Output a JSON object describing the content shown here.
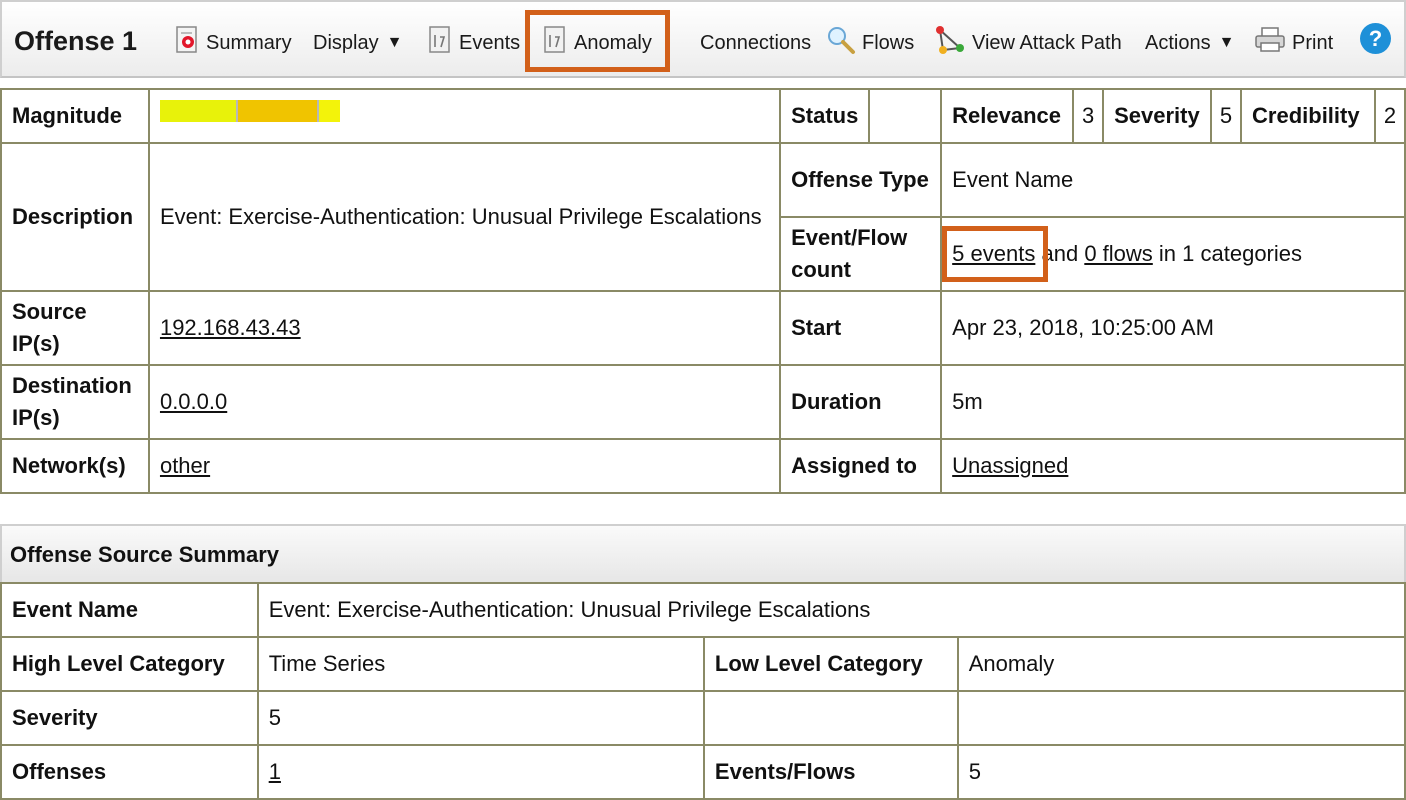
{
  "toolbar": {
    "title": "Offense 1",
    "summary": "Summary",
    "display": "Display",
    "events": "Events",
    "anomaly": "Anomaly",
    "connections": "Connections",
    "flows": "Flows",
    "view_attack_path": "View Attack Path",
    "actions": "Actions",
    "print": "Print",
    "caret": "▼",
    "help": "?"
  },
  "highlight_color": "#d2601a",
  "offense": {
    "magnitude_label": "Magnitude",
    "magnitude": {
      "segment_colors": [
        "#e8f20a",
        "#f0c400",
        "#f3f30a"
      ],
      "segment_fractions": [
        0.42,
        0.45,
        0.13
      ]
    },
    "status_label": "Status",
    "status_value": "",
    "relevance_label": "Relevance",
    "relevance_value": "3",
    "severity_label": "Severity",
    "severity_value": "5",
    "credibility_label": "Credibility",
    "credibility_value": "2",
    "description_label": "Description",
    "description_value": "Event: Exercise-Authentication: Unusual Privilege Escalations",
    "offense_type_label": "Offense Type",
    "offense_type_value": "Event Name",
    "event_flow_label": "Event/Flow count",
    "events_link": "5 events",
    "and_text": "and",
    "flows_link": "0 flows",
    "categories_text": "in 1 categories",
    "source_ip_label": "Source IP(s)",
    "source_ip_value": "192.168.43.43",
    "start_label": "Start",
    "start_value": "Apr 23, 2018, 10:25:00 AM",
    "destination_ip_label": "Destination IP(s)",
    "destination_ip_value": "0.0.0.0",
    "duration_label": "Duration",
    "duration_value": "5m",
    "network_label": "Network(s)",
    "network_value": "other",
    "assigned_label": "Assigned to",
    "assigned_value": "Unassigned"
  },
  "source_summary": {
    "title": "Offense Source Summary",
    "event_name_label": "Event Name",
    "event_name_value": "Event: Exercise-Authentication: Unusual Privilege Escalations",
    "high_level_label": "High Level Category",
    "high_level_value": "Time Series",
    "low_level_label": "Low Level Category",
    "low_level_value": "Anomaly",
    "severity_label": "Severity",
    "severity_value": "5",
    "offenses_label": "Offenses",
    "offenses_value": "1",
    "events_flows_label": "Events/Flows",
    "events_flows_value": "5"
  }
}
